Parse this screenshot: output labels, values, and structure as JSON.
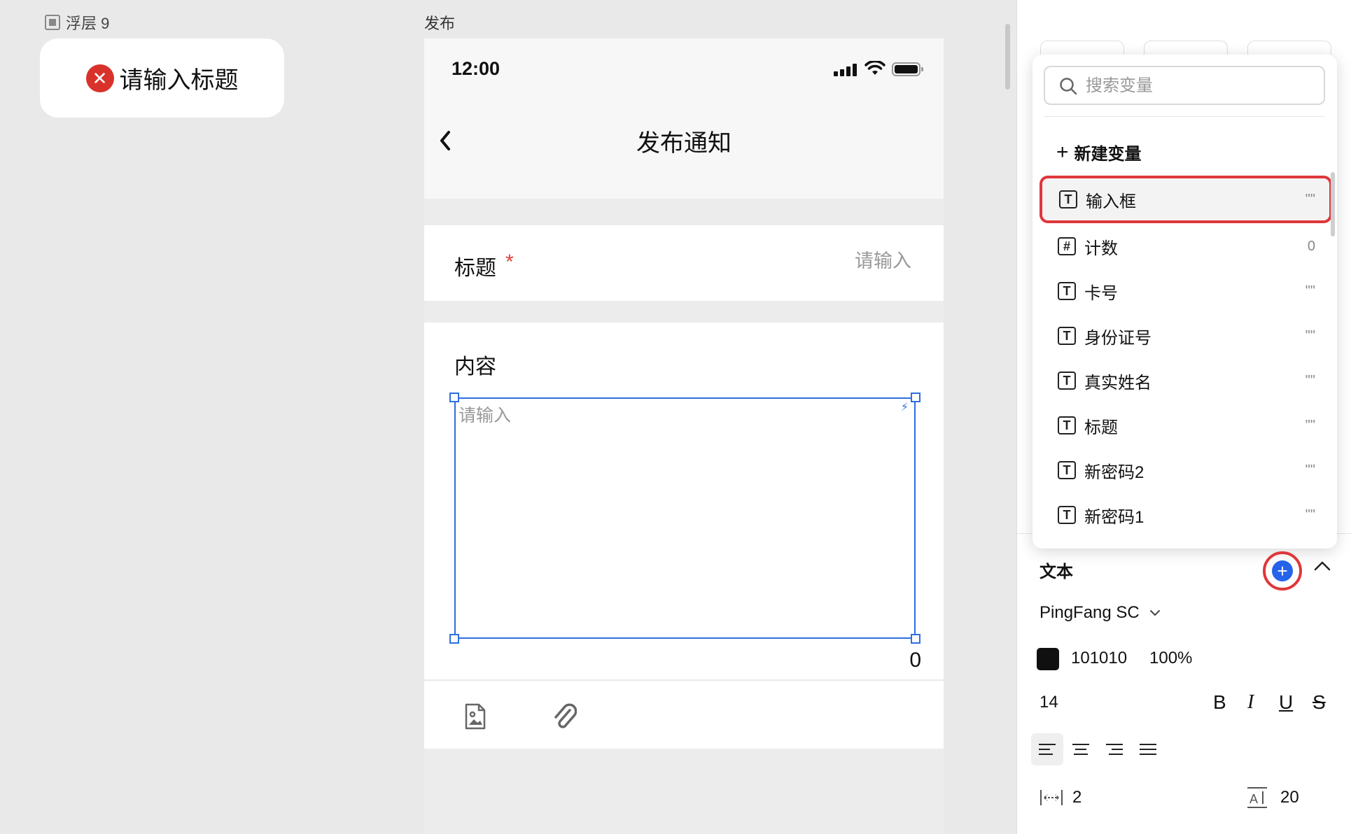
{
  "canvas": {
    "layer_label": "浮层 9",
    "toast_text": "请输入标题",
    "frame_label": "发布"
  },
  "phone": {
    "status_time": "12:00",
    "nav_title": "发布通知",
    "title_field": {
      "label": "标题",
      "required_mark": "*",
      "placeholder": "请输入"
    },
    "content_field": {
      "label": "内容",
      "placeholder": "请输入",
      "char_count": "0"
    }
  },
  "variable_picker": {
    "search_placeholder": "搜索变量",
    "new_variable_label": "新建变量",
    "items": [
      {
        "type_icon": "T",
        "name": "输入框",
        "value": "\"\""
      },
      {
        "type_icon": "#",
        "name": "计数",
        "value": "0"
      },
      {
        "type_icon": "T",
        "name": "卡号",
        "value": "\"\""
      },
      {
        "type_icon": "T",
        "name": "身份证号",
        "value": "\"\""
      },
      {
        "type_icon": "T",
        "name": "真实姓名",
        "value": "\"\""
      },
      {
        "type_icon": "T",
        "name": "标题",
        "value": "\"\""
      },
      {
        "type_icon": "T",
        "name": "新密码2",
        "value": "\"\""
      },
      {
        "type_icon": "T",
        "name": "新密码1",
        "value": "\"\""
      }
    ],
    "selected_index": 0
  },
  "text_panel": {
    "section_title": "文本",
    "font_family": "PingFang SC",
    "color_hex": "101010",
    "color_opacity": "100%",
    "font_size": "14",
    "format_buttons": [
      "B",
      "I",
      "U",
      "S"
    ],
    "letter_spacing": "2",
    "line_height": "20"
  },
  "colors": {
    "accent": "#2f6fe0",
    "highlight_ring": "#e0373a",
    "error": "#d9322b",
    "text_color_swatch": "#101010"
  }
}
